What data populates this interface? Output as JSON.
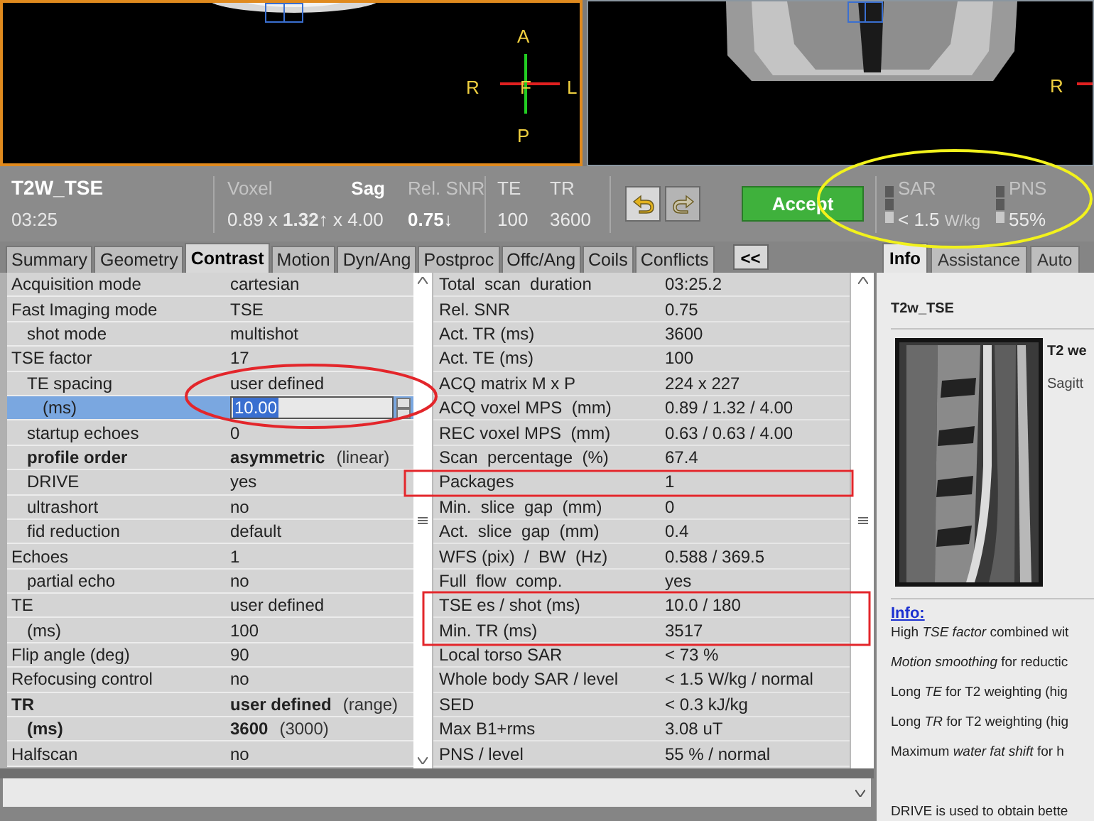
{
  "viewports": [
    {
      "active": true,
      "labels": {
        "top": "A",
        "left": "R",
        "center": "F",
        "right": "L",
        "bottom": "P"
      }
    },
    {
      "active": false,
      "labels": {
        "left": "R"
      }
    }
  ],
  "scan": {
    "name": "T2W_TSE",
    "duration": "03:25"
  },
  "voxel": {
    "label": "Voxel",
    "orientation": "Sag",
    "value": "0.89 x **1.32↑** x 4.00"
  },
  "snr": {
    "label": "Rel. SNR",
    "value": "0.75↓"
  },
  "te": {
    "label": "TE",
    "value": "100"
  },
  "tr": {
    "label": "TR",
    "value": "3600"
  },
  "history_buttons": [
    {
      "kind": "undo",
      "disabled": false
    },
    {
      "kind": "redo",
      "disabled": true
    }
  ],
  "accept_button": "Accept",
  "sar": {
    "label": "SAR",
    "value": "< 1.5",
    "unit": "W/kg"
  },
  "pns": {
    "label": "PNS",
    "value": "55%"
  },
  "tabs": [
    {
      "label": "Summary",
      "selected": false
    },
    {
      "label": "Geometry",
      "selected": false
    },
    {
      "label": "Contrast",
      "selected": true
    },
    {
      "label": "Motion",
      "selected": false
    },
    {
      "label": "Dyn/Ang",
      "selected": false
    },
    {
      "label": "Postproc",
      "selected": false
    },
    {
      "label": "Offc/Ang",
      "selected": false
    },
    {
      "label": "Coils",
      "selected": false
    },
    {
      "label": "Conflicts",
      "selected": false
    }
  ],
  "collapse_button": "<<",
  "parameters": [
    {
      "label": "Acquisition  mode",
      "value": "cartesian",
      "kind": "text",
      "bold": false,
      "selected": false
    },
    {
      "label": "Fast Imaging mode",
      "value": "TSE",
      "kind": "text",
      "bold": false,
      "selected": false,
      "children": [
        {
          "label": "shot mode",
          "value": "multishot",
          "kind": "text",
          "bold": false,
          "selected": false
        }
      ]
    },
    {
      "label": "TSE factor",
      "value": "17",
      "kind": "text",
      "bold": false,
      "selected": false,
      "children": [
        {
          "label": "TE spacing",
          "value": "user defined",
          "kind": "text",
          "bold": false,
          "selected": false,
          "children": [
            {
              "label": "(ms)",
              "value": "10.00",
              "kind": "field",
              "bold": false,
              "selected": true
            }
          ]
        },
        {
          "label": "startup echoes",
          "value": "0",
          "kind": "text",
          "bold": false,
          "selected": false
        },
        {
          "label": "profile order",
          "value": "asymmetric",
          "note": "(linear)",
          "kind": "text",
          "bold": true,
          "selected": false
        },
        {
          "label": "DRIVE",
          "value": "yes",
          "kind": "text",
          "bold": false,
          "selected": false
        },
        {
          "label": "ultrashort",
          "value": "no",
          "kind": "text",
          "bold": false,
          "selected": false
        },
        {
          "label": "fid reduction",
          "value": "default",
          "kind": "text",
          "bold": false,
          "selected": false
        }
      ]
    },
    {
      "label": "Echoes",
      "value": "1",
      "kind": "text",
      "bold": false,
      "selected": false,
      "children": [
        {
          "label": "partial echo",
          "value": "no",
          "kind": "text",
          "bold": false,
          "selected": false
        }
      ]
    },
    {
      "label": "TE",
      "value": "user defined",
      "kind": "text",
      "bold": false,
      "selected": false,
      "children": [
        {
          "label": "(ms)",
          "value": "100",
          "kind": "text",
          "bold": false,
          "selected": false
        }
      ]
    },
    {
      "label": "Flip angle (deg)",
      "value": "90",
      "kind": "text",
      "bold": false,
      "selected": false
    },
    {
      "label": "Refocusing  control",
      "value": "no",
      "kind": "text",
      "bold": false,
      "selected": false
    },
    {
      "label": "TR",
      "value": "user defined",
      "note": "(range)",
      "kind": "text",
      "bold": true,
      "selected": false,
      "children": [
        {
          "label": "(ms)",
          "value": "3600",
          "note": "(3000)",
          "kind": "text",
          "bold": true,
          "selected": false
        }
      ]
    },
    {
      "label": "Halfscan",
      "value": "no",
      "kind": "text",
      "bold": false,
      "selected": false
    }
  ],
  "results": [
    {
      "label": "Total  scan  duration",
      "value": "03:25.2"
    },
    {
      "label": "Rel. SNR",
      "value": "0.75"
    },
    {
      "label": "Act. TR (ms)",
      "value": "3600"
    },
    {
      "label": "Act. TE (ms)",
      "value": "100"
    },
    {
      "label": "ACQ matrix M x P",
      "value": "224 x 227"
    },
    {
      "label": "ACQ voxel MPS  (mm)",
      "value": "0.89 / 1.32 / 4.00"
    },
    {
      "label": "REC voxel MPS  (mm)",
      "value": "0.63 / 0.63 / 4.00"
    },
    {
      "label": "Scan  percentage  (%)",
      "value": "67.4"
    },
    {
      "label": "Packages",
      "value": "1"
    },
    {
      "label": "Min.  slice  gap  (mm)",
      "value": "0"
    },
    {
      "label": "Act.  slice  gap  (mm)",
      "value": "0.4"
    },
    {
      "label": "WFS (pix)  /  BW  (Hz)",
      "value": "0.588 / 369.5"
    },
    {
      "label": "Full  flow  comp.",
      "value": "yes"
    },
    {
      "label": "TSE es / shot (ms)",
      "value": "10.0 / 180"
    },
    {
      "label": "Min. TR (ms)",
      "value": "3517"
    },
    {
      "label": "Local torso SAR",
      "value": "< 73 %"
    },
    {
      "label": "Whole body SAR / level",
      "value": "< 1.5 W/kg / normal"
    },
    {
      "label": "SED",
      "value": "< 0.3 kJ/kg"
    },
    {
      "label": "Max B1+rms",
      "value": "3.08 uT"
    },
    {
      "label": "PNS / level",
      "value": "55 % / normal"
    }
  ],
  "info_panel": {
    "tabs": [
      {
        "label": "Info",
        "selected": true
      },
      {
        "label": "Assistance",
        "selected": false
      },
      {
        "label": "Auto",
        "selected": false
      }
    ],
    "title": "T2w_TSE",
    "caption_title": "T2 we",
    "caption": "Sagitt",
    "info_link": "Info:",
    "notes": [
      "High *TSE factor* combined wit",
      "*Motion smoothing* for reductic",
      "Long *TE* for T2 weighting (hig",
      "Long *TR* for T2 weighting (hig",
      "Maximum *water fat shift* for h",
      "DRIVE is used to obtain bette"
    ]
  }
}
